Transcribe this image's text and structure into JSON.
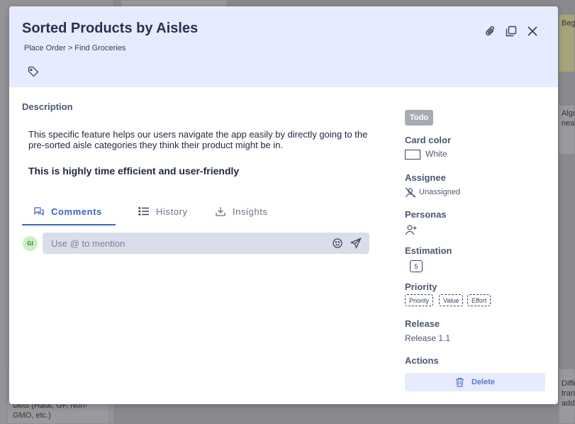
{
  "background": {
    "right_snippet_top": "Beg",
    "right_snippet_mid": "Algo\nnea",
    "left_snippet_bottom": "diets (Halal, GF, Non-\nGMO, etc.)",
    "right_snippet_bottom": "Diffe\ntran\nadd"
  },
  "modal": {
    "title": "Sorted Products by Aisles",
    "breadcrumb": "Place Order > Find Groceries",
    "description_label": "Description",
    "description_text": "This specific feature helps our users navigate the app easily by directly going to the pre-sorted aisle categories they think their product might be in.",
    "description_bold": "This is highly time efficient and user-friendly",
    "tabs": [
      {
        "label": "Comments",
        "icon": "comments-icon"
      },
      {
        "label": "History",
        "icon": "list-icon"
      },
      {
        "label": "Insights",
        "icon": "download-icon"
      }
    ],
    "comment": {
      "avatar_initials": "GI",
      "placeholder": "Use @ to mention",
      "value": ""
    }
  },
  "sidebar": {
    "status": "Todo",
    "card_color_label": "Card color",
    "card_color_value": "White",
    "assignee_label": "Assignee",
    "assignee_value": "Unassigned",
    "personas_label": "Personas",
    "estimation_label": "Estimation",
    "estimation_value": "5",
    "priority_label": "Priority",
    "priority_chips": [
      "Priority",
      "Value",
      "Effort"
    ],
    "release_label": "Release",
    "release_value": "Release 1.1",
    "actions_label": "Actions",
    "delete_label": "Delete"
  },
  "colors": {
    "header_bg": "#e6ecfe",
    "accent": "#3a62c9",
    "overlay": "#8a8a8e",
    "status_bg": "#a7abb6"
  }
}
